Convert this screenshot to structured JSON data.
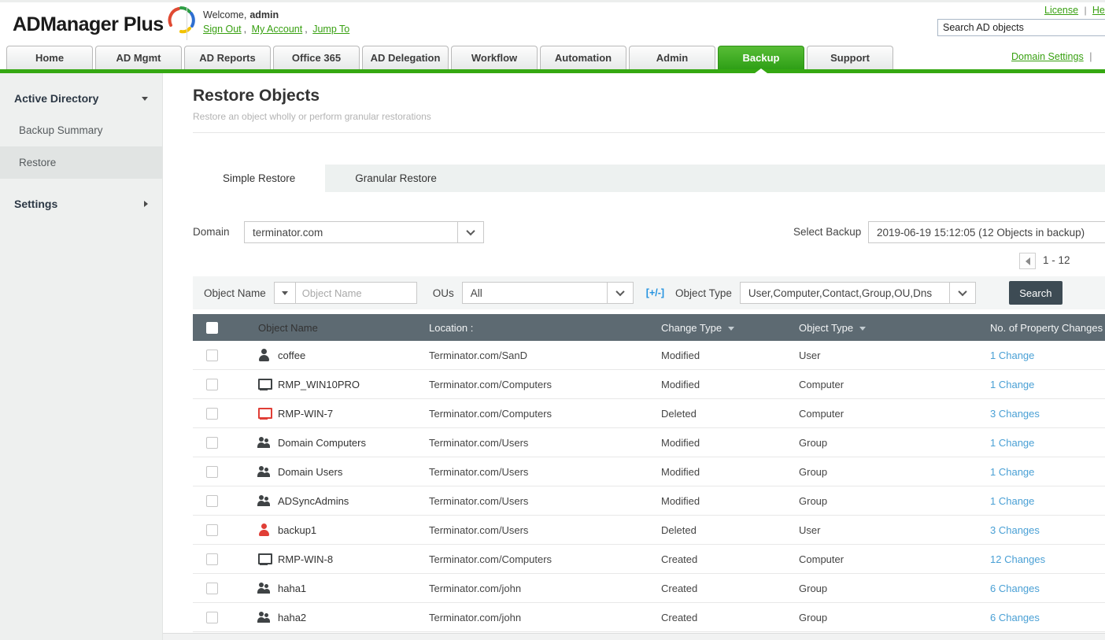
{
  "header": {
    "logo_text": "ADManager Plus",
    "welcome_label": "Welcome,",
    "username": "admin",
    "links": {
      "sign_out": "Sign Out",
      "my_account": "My Account",
      "jump_to": "Jump To"
    },
    "top_links": {
      "license": "License",
      "separator": "|",
      "help": "Help"
    },
    "search_text": "Search AD objects"
  },
  "nav": {
    "tabs": [
      {
        "label": "Home"
      },
      {
        "label": "AD Mgmt"
      },
      {
        "label": "AD Reports"
      },
      {
        "label": "Office 365"
      },
      {
        "label": "AD Delegation"
      },
      {
        "label": "Workflow"
      },
      {
        "label": "Automation"
      },
      {
        "label": "Admin"
      },
      {
        "label": "Backup",
        "active": true
      },
      {
        "label": "Support"
      }
    ],
    "domain_settings": "Domain Settings",
    "domain_settings_separator": "|"
  },
  "sidebar": {
    "sections": [
      {
        "label": "Active Directory",
        "expanded": true,
        "items": [
          {
            "label": "Backup Summary",
            "active": false
          },
          {
            "label": "Restore",
            "active": true
          }
        ]
      },
      {
        "label": "Settings",
        "expanded": false,
        "items": []
      }
    ]
  },
  "main": {
    "title": "Restore Objects",
    "subtitle": "Restore an object wholly or perform granular restorations",
    "tabs": [
      {
        "label": "Simple Restore",
        "active": true
      },
      {
        "label": "Granular Restore",
        "active": false
      }
    ],
    "domain": {
      "label": "Domain",
      "value": "terminator.com"
    },
    "select_backup": {
      "label": "Select Backup",
      "value": "2019-06-19 15:12:05 (12 Objects in backup)"
    },
    "pagination": {
      "range": "1 - 12"
    },
    "filters": {
      "field_selector_label": "Object Name",
      "name_input_placeholder": "Object Name",
      "ous_label": "OUs",
      "ous_value": "All",
      "expand_toggle": "[+/-]",
      "object_type_label": "Object Type",
      "object_type_value": "User,Computer,Contact,Group,OU,Dns",
      "search_button": "Search"
    },
    "table": {
      "headers": {
        "object_name": "Object Name",
        "location": "Location :",
        "change_type": "Change Type",
        "object_type": "Object Type",
        "changes": "No. of Property Changes"
      },
      "rows": [
        {
          "name": "coffee",
          "icon": "user",
          "deleted": false,
          "location": "Terminator.com/SanD",
          "change_type": "Modified",
          "object_type": "User",
          "changes": "1 Change"
        },
        {
          "name": "RMP_WIN10PRO",
          "icon": "computer",
          "deleted": false,
          "location": "Terminator.com/Computers",
          "change_type": "Modified",
          "object_type": "Computer",
          "changes": "1 Change"
        },
        {
          "name": "RMP-WIN-7",
          "icon": "computer",
          "deleted": true,
          "location": "Terminator.com/Computers",
          "change_type": "Deleted",
          "object_type": "Computer",
          "changes": "3 Changes"
        },
        {
          "name": "Domain Computers",
          "icon": "group",
          "deleted": false,
          "location": "Terminator.com/Users",
          "change_type": "Modified",
          "object_type": "Group",
          "changes": "1 Change"
        },
        {
          "name": "Domain Users",
          "icon": "group",
          "deleted": false,
          "location": "Terminator.com/Users",
          "change_type": "Modified",
          "object_type": "Group",
          "changes": "1 Change"
        },
        {
          "name": "ADSyncAdmins",
          "icon": "group",
          "deleted": false,
          "location": "Terminator.com/Users",
          "change_type": "Modified",
          "object_type": "Group",
          "changes": "1 Change"
        },
        {
          "name": "backup1",
          "icon": "user",
          "deleted": true,
          "location": "Terminator.com/Users",
          "change_type": "Deleted",
          "object_type": "User",
          "changes": "3 Changes"
        },
        {
          "name": "RMP-WIN-8",
          "icon": "computer",
          "deleted": false,
          "location": "Terminator.com/Computers",
          "change_type": "Created",
          "object_type": "Computer",
          "changes": "12 Changes"
        },
        {
          "name": "haha1",
          "icon": "group",
          "deleted": false,
          "location": "Terminator.com/john",
          "change_type": "Created",
          "object_type": "Group",
          "changes": "6 Changes"
        },
        {
          "name": "haha2",
          "icon": "group",
          "deleted": false,
          "location": "Terminator.com/john",
          "change_type": "Created",
          "object_type": "Group",
          "changes": "6 Changes"
        }
      ]
    }
  },
  "colors": {
    "accent_green": "#35a812",
    "link_green": "#38a011",
    "table_header_bg": "#5d6a72",
    "link_blue": "#4aa0d5",
    "deleted_red": "#e03e36",
    "search_button_bg": "#3d4b54"
  },
  "icons": {
    "logo_swirl": "multicolor-swirl",
    "dropdown": "chevron-down",
    "sort": "caret-down",
    "prev_page": "left-arrow",
    "row_icons": [
      "user",
      "computer",
      "group"
    ]
  }
}
